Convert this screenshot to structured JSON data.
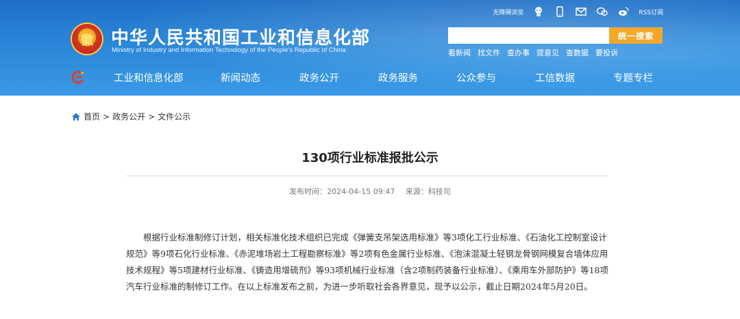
{
  "header": {
    "emblem_char": "徽",
    "title": "中华人民共和国工业和信息化部",
    "subtitle": "Ministry of Industry and Information Technology of the People's Republic of China",
    "top_links": {
      "accessibility": "无障碍浏览",
      "rss": "RSS订阅"
    },
    "icons": [
      "robot-icon",
      "mobile-icon",
      "mail-icon",
      "wechat-icon",
      "weibo-icon"
    ],
    "search": {
      "placeholder": "",
      "button": "统一搜索"
    },
    "quick_links": [
      "看新闻",
      "找文件",
      "查办事",
      "提意见",
      "查数据",
      "要投诉"
    ]
  },
  "nav": {
    "items": [
      "工业和信息化部",
      "新闻动态",
      "政务公开",
      "政务服务",
      "公众参与",
      "工信数据",
      "专题专栏"
    ]
  },
  "breadcrumb": [
    "首页",
    ">",
    "政务公开",
    ">",
    "文件公示"
  ],
  "article": {
    "title": "130项行业标准报批公示",
    "published_label": "发布时间：",
    "published": "2024-04-15 09:47",
    "source_label": "来源：",
    "source": "科技司",
    "body": "根据行业标准制修订计划，相关标准化技术组织已完成《弹簧支吊架选用标准》等3项化工行业标准、《石油化工控制室设计规范》等9项石化行业标准、《赤泥堆场岩土工程勘察标准》等2项有色金属行业标准、《泡沫混凝土轻钢龙骨钢网模复合墙体应用技术规程》等5项建材行业标准、《铸造用增硫剂》等93项机械行业标准（含2项制药装备行业标准）、《乘用车外部防护》等18项汽车行业标准的制修订工作。在以上标准发布之前，为进一步听取社会各界意见，现予以公示，截止日期2024年5月20日。"
  },
  "colors": {
    "header_blue": "#2a86d8",
    "search_orange": "#f3a82a",
    "breadcrumb_home": "#2a7bd0"
  }
}
